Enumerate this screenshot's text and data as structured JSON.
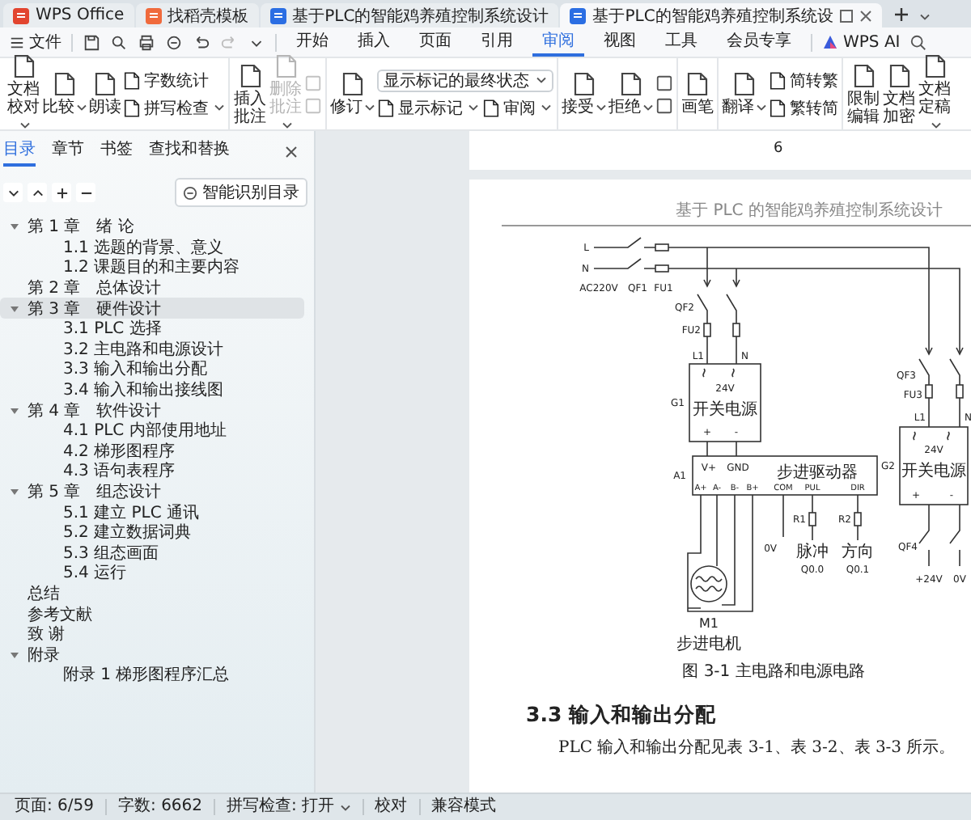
{
  "title_tabs": [
    {
      "label": "WPS Office",
      "kind": "home",
      "selected": false
    },
    {
      "label": "找稻壳模板",
      "kind": "template",
      "selected": false
    },
    {
      "label": "基于PLC的智能鸡养殖控制系统设计",
      "kind": "doc",
      "selected": false
    },
    {
      "label": "基于PLC的智能鸡养殖控制系统设",
      "kind": "doc",
      "selected": true
    }
  ],
  "menu": {
    "file": "文件",
    "quick_access": [
      {
        "disabled": false
      },
      {
        "disabled": false
      },
      {
        "disabled": false
      },
      {
        "disabled": false
      },
      {
        "disabled": false
      },
      {
        "disabled": true
      },
      {
        "disabled": false
      }
    ],
    "tabs": [
      {
        "label": "开始",
        "selected": false
      },
      {
        "label": "插入",
        "selected": false
      },
      {
        "label": "页面",
        "selected": false
      },
      {
        "label": "引用",
        "selected": false
      },
      {
        "label": "审阅",
        "selected": true
      },
      {
        "label": "视图",
        "selected": false
      },
      {
        "label": "工具",
        "selected": false
      },
      {
        "label": "会员专享",
        "selected": false
      }
    ],
    "ai": "WPS AI"
  },
  "ribbon": [
    {
      "items": [
        {
          "kind": "large",
          "label": "文档校对",
          "dropdown": true
        },
        {
          "kind": "large",
          "label": "比较",
          "dropdown": true
        },
        {
          "kind": "large",
          "label": "朗读",
          "dropdown": false
        },
        {
          "kind": "stack",
          "rows": [
            [
              {
                "kind": "small",
                "label": "字数统计",
                "dropdown": false,
                "disabled": false
              }
            ],
            [
              {
                "kind": "small",
                "label": "拼写检查",
                "dropdown": true,
                "disabled": false
              }
            ]
          ]
        }
      ]
    },
    {
      "items": [
        {
          "kind": "large",
          "label": "插入批注",
          "dropdown": false,
          "disabled": false
        },
        {
          "kind": "large",
          "label": "删除批注",
          "dropdown": true,
          "disabled": true
        },
        {
          "kind": "stack",
          "rows": [
            [
              {
                "kind": "icon",
                "disabled": true
              }
            ],
            [
              {
                "kind": "icon",
                "disabled": true
              }
            ]
          ]
        }
      ]
    },
    {
      "items": [
        {
          "kind": "large",
          "label": "修订",
          "dropdown": true
        },
        {
          "kind": "stack",
          "rows": [
            [
              {
                "kind": "select",
                "label": "显示标记的最终状态"
              }
            ],
            [
              {
                "kind": "small",
                "label": "显示标记",
                "dropdown": true,
                "disabled": false
              },
              {
                "kind": "small",
                "label": "审阅",
                "dropdown": true,
                "disabled": false
              }
            ]
          ]
        }
      ]
    },
    {
      "items": [
        {
          "kind": "large",
          "label": "接受",
          "dropdown": true
        },
        {
          "kind": "large",
          "label": "拒绝",
          "dropdown": true
        },
        {
          "kind": "stack",
          "rows": [
            [
              {
                "kind": "icon",
                "disabled": false
              }
            ],
            [
              {
                "kind": "icon",
                "disabled": false
              }
            ]
          ]
        }
      ]
    },
    {
      "items": [
        {
          "kind": "large",
          "label": "画笔",
          "dropdown": false
        }
      ]
    },
    {
      "items": [
        {
          "kind": "large",
          "label": "翻译",
          "dropdown": true
        },
        {
          "kind": "stack",
          "rows": [
            [
              {
                "kind": "small",
                "label": "简转繁",
                "dropdown": false,
                "disabled": false
              }
            ],
            [
              {
                "kind": "small",
                "label": "繁转简",
                "dropdown": false,
                "disabled": false
              }
            ]
          ]
        }
      ]
    },
    {
      "items": [
        {
          "kind": "large",
          "label": "限制编辑",
          "dropdown": false
        },
        {
          "kind": "large",
          "label": "文档加密",
          "dropdown": false
        },
        {
          "kind": "large",
          "label": "文档定稿",
          "dropdown": true
        }
      ]
    }
  ],
  "sidebar": {
    "tabs": [
      {
        "label": "目录",
        "selected": true
      },
      {
        "label": "章节",
        "selected": false
      },
      {
        "label": "书签",
        "selected": false
      },
      {
        "label": "查找和替换",
        "selected": false
      }
    ],
    "smart_toc": "智能识别目录",
    "toc": [
      {
        "label": "第 1 章　绪  论",
        "selected": false,
        "expanded": true,
        "children": [
          {
            "label": "1.1 选题的背景、意义",
            "selected": false
          },
          {
            "label": "1.2 课题目的和主要内容",
            "selected": false
          }
        ]
      },
      {
        "label": "第 2 章　总体设计",
        "selected": false
      },
      {
        "label": "第 3 章　硬件设计",
        "selected": true,
        "expanded": true,
        "children": [
          {
            "label": "3.1 PLC 选择",
            "selected": false
          },
          {
            "label": "3.2 主电路和电源设计",
            "selected": false
          },
          {
            "label": "3.3 输入和输出分配",
            "selected": false
          },
          {
            "label": "3.4 输入和输出接线图",
            "selected": false
          }
        ]
      },
      {
        "label": "第 4 章　软件设计",
        "selected": false,
        "expanded": true,
        "children": [
          {
            "label": "4.1 PLC 内部使用地址",
            "selected": false
          },
          {
            "label": "4.2 梯形图程序",
            "selected": false
          },
          {
            "label": "4.3 语句表程序",
            "selected": false
          }
        ]
      },
      {
        "label": "第 5 章　组态设计",
        "selected": false,
        "expanded": true,
        "children": [
          {
            "label": "5.1 建立 PLC 通讯",
            "selected": false
          },
          {
            "label": "5.2 建立数据词典",
            "selected": false
          },
          {
            "label": "5.3 组态画面",
            "selected": false
          },
          {
            "label": "5.4 运行",
            "selected": false
          }
        ]
      },
      {
        "label": "总结",
        "selected": false
      },
      {
        "label": "参考文献",
        "selected": false
      },
      {
        "label": "致  谢",
        "selected": false
      },
      {
        "label": "附录",
        "selected": false,
        "expanded": true,
        "children": [
          {
            "label": "附录 1  梯形图程序汇总",
            "selected": false
          }
        ]
      }
    ]
  },
  "document": {
    "page_number": "6",
    "header": "基于 PLC 的智能鸡养殖控制系统设计",
    "diagram": {
      "labels": [
        "L",
        "N",
        "AC220V",
        "QF1",
        "FU1",
        "QF2",
        "FU2",
        "L1",
        "N",
        "G1",
        "24V",
        "开关电源",
        "+",
        "-",
        "A1",
        "V+",
        "GND",
        "步进驱动器",
        "A+",
        "A-",
        "B-",
        "B+",
        "COM",
        "PUL",
        "DIR",
        "R1",
        "R2",
        "0V",
        "脉冲",
        "Q0.0",
        "方向",
        "Q0.1",
        "M1",
        "步进电机",
        "QF3",
        "FU3",
        "L1",
        "N",
        "G2",
        "24V",
        "开关电源",
        "+",
        "-",
        "QF4",
        "+24V",
        "0V"
      ]
    },
    "caption": "图 3-1 主电路和电源电路",
    "heading": "3.3 输入和输出分配",
    "paragraph": "PLC 输入和输出分配见表 3-1、表 3-2、表 3-3 所示。"
  },
  "status_bar": [
    {
      "kind": "text",
      "label": "页面: 6/59"
    },
    {
      "kind": "text",
      "label": "字数: 6662"
    },
    {
      "kind": "dropdown",
      "label": "拼写检查: 打开"
    },
    {
      "kind": "text",
      "label": "校对"
    },
    {
      "kind": "text",
      "label": "兼容模式"
    }
  ]
}
